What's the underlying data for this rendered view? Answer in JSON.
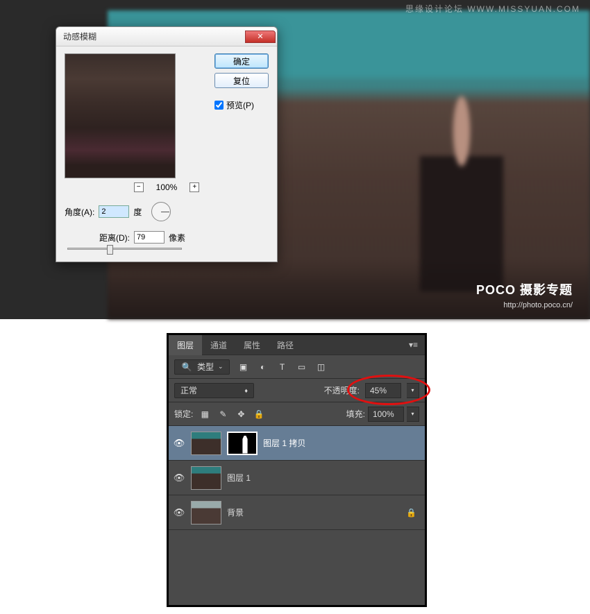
{
  "watermark_top": "思缘设计论坛  WWW.MISSYUAN.COM",
  "poco": {
    "logo": "POCO 摄影专题",
    "url": "http://photo.poco.cn/"
  },
  "dialog": {
    "title": "动感模糊",
    "ok": "确定",
    "reset": "复位",
    "preview_label": "预览(P)",
    "zoom": "100%",
    "angle_label": "角度(A):",
    "angle_value": "2",
    "angle_unit": "度",
    "distance_label": "距离(D):",
    "distance_value": "79",
    "distance_unit": "像素"
  },
  "panel": {
    "tabs": {
      "layers": "图层",
      "channels": "通道",
      "properties": "属性",
      "paths": "路径"
    },
    "filter_kind": "类型",
    "blend_mode": "正常",
    "opacity_label": "不透明度:",
    "opacity_value": "45%",
    "lock_label": "锁定:",
    "fill_label": "填充:",
    "fill_value": "100%",
    "layers_list": {
      "l1": "图层 1 拷贝",
      "l2": "图层 1",
      "l3": "背景"
    }
  }
}
